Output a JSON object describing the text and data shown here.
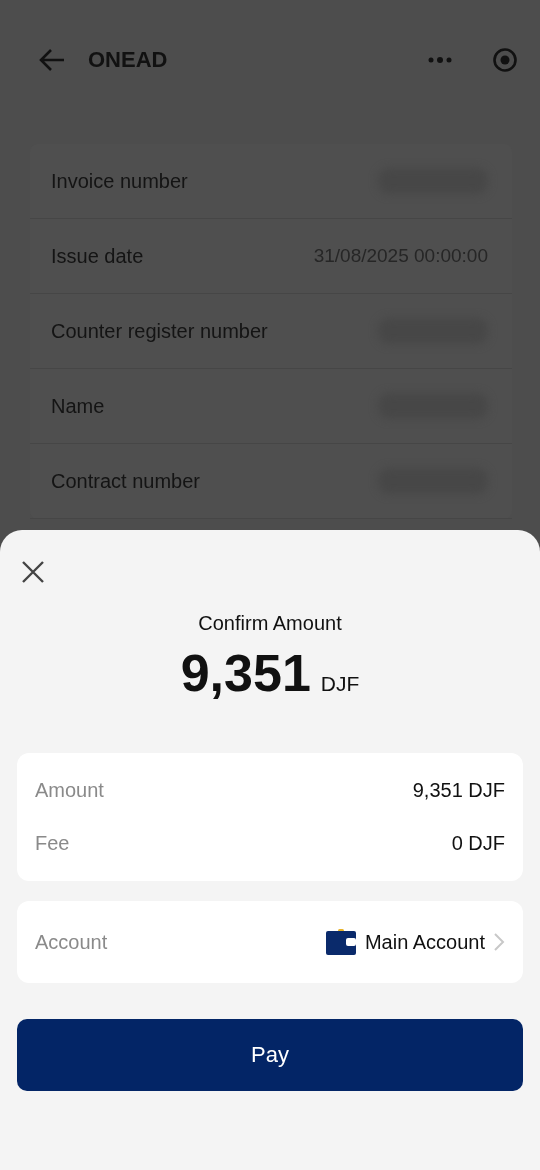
{
  "header": {
    "title": "ONEAD"
  },
  "details": [
    {
      "label": "Invoice number",
      "kind": "blurred"
    },
    {
      "label": "Issue date",
      "kind": "text",
      "value": "31/08/2025 00:00:00"
    },
    {
      "label": "Counter register number",
      "kind": "blurred"
    },
    {
      "label": "Name",
      "kind": "blurred"
    },
    {
      "label": "Contract number",
      "kind": "blurred"
    }
  ],
  "sheet": {
    "title": "Confirm Amount",
    "amount": "9,351",
    "currency": "DJF",
    "summary": [
      {
        "label": "Amount",
        "value": "9,351 DJF"
      },
      {
        "label": "Fee",
        "value": "0 DJF"
      }
    ],
    "account": {
      "label": "Account",
      "value": "Main Account"
    },
    "pay_button": "Pay"
  }
}
